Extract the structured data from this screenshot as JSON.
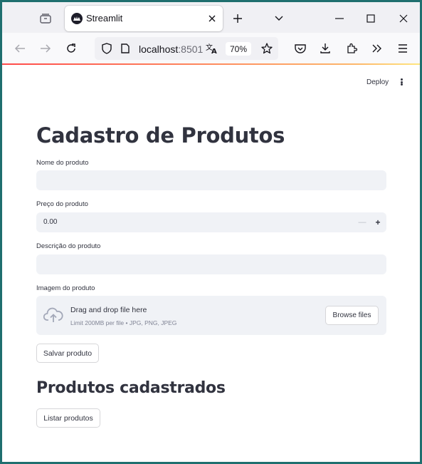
{
  "browser": {
    "tab": {
      "title": "Streamlit"
    },
    "url": {
      "host": "localhost",
      "port": ":8501"
    },
    "zoom": "70%"
  },
  "app": {
    "toolbar": {
      "deploy_label": "Deploy"
    },
    "title": "Cadastro de Produtos",
    "fields": {
      "name": {
        "label": "Nome do produto",
        "value": ""
      },
      "price": {
        "label": "Preço do produto",
        "value": "0.00",
        "minus": "—",
        "plus": "+"
      },
      "description": {
        "label": "Descrição do produto",
        "value": ""
      },
      "image": {
        "label": "Imagem do produto",
        "dropzone_title": "Drag and drop file here",
        "dropzone_limit": "Limit 200MB per file • JPG, PNG, JPEG",
        "browse_label": "Browse files"
      }
    },
    "save_button": "Salvar produto",
    "list_title": "Produtos cadastrados",
    "list_button": "Listar produtos"
  },
  "colors": {
    "text": "#31333f",
    "input_bg": "#f0f2f6",
    "accent": "#ff4b4b"
  }
}
